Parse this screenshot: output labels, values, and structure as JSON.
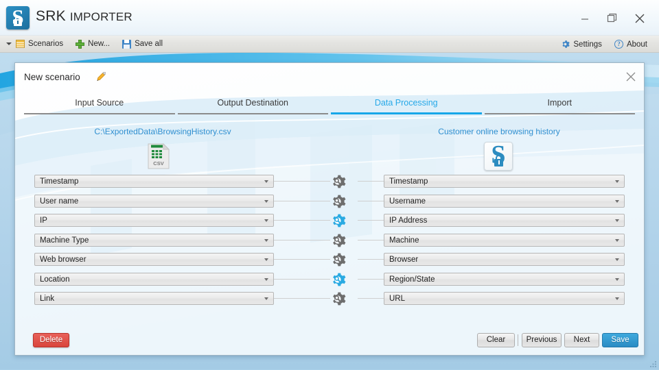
{
  "window": {
    "app_title_bold": "SRK",
    "app_title_light": "IMPORTER",
    "logo_letter": "S",
    "minimize_label": "Minimize",
    "maximize_label": "Restore",
    "close_label": "Close"
  },
  "toolbar": {
    "items": [
      {
        "label": "Scenarios",
        "icon": "scenarios-icon",
        "has_caret": true
      },
      {
        "label": "New...",
        "icon": "plus-icon",
        "has_caret": false
      },
      {
        "label": "Save all",
        "icon": "floppy-disk-icon",
        "has_caret": false
      }
    ],
    "right_items": [
      {
        "label": "Settings",
        "icon": "gear-icon"
      },
      {
        "label": "About",
        "icon": "question-circle-icon"
      }
    ]
  },
  "panel": {
    "scenario_title": "New scenario",
    "edit_icon": "pencil-icon",
    "close_icon": "close-icon"
  },
  "tabs": [
    {
      "label": "Input Source",
      "active": false
    },
    {
      "label": "Output Destination",
      "active": false
    },
    {
      "label": "Data Processing",
      "active": true
    },
    {
      "label": "Import",
      "active": false
    }
  ],
  "source": {
    "path": "C:\\ExportedData\\BrowsingHistory.csv",
    "icon": "csv-file-icon",
    "icon_label": "CSV"
  },
  "target": {
    "name": "Customer online browsing history",
    "icon": "srk-app-icon",
    "logo_letter": "S"
  },
  "mappings": [
    {
      "source_field": "Timestamp",
      "target_field": "Timestamp",
      "gear_active": false
    },
    {
      "source_field": "User name",
      "target_field": "Username",
      "gear_active": false
    },
    {
      "source_field": "IP",
      "target_field": "IP Address",
      "gear_active": true
    },
    {
      "source_field": "Machine Type",
      "target_field": "Machine",
      "gear_active": false
    },
    {
      "source_field": "Web browser",
      "target_field": "Browser",
      "gear_active": false
    },
    {
      "source_field": "Location",
      "target_field": "Region/State",
      "gear_active": true
    },
    {
      "source_field": "Link",
      "target_field": "URL",
      "gear_active": false
    }
  ],
  "footer": {
    "delete_label": "Delete",
    "clear_label": "Clear",
    "previous_label": "Previous",
    "next_label": "Next",
    "save_label": "Save"
  },
  "colors": {
    "accent_blue": "#2f8fd0",
    "active_tab": "#25a8e8",
    "gear_active": "#2aaae2",
    "gear_inactive": "#6d6d6d",
    "delete_red": "#d9453c",
    "save_blue": "#2a8cc4"
  }
}
